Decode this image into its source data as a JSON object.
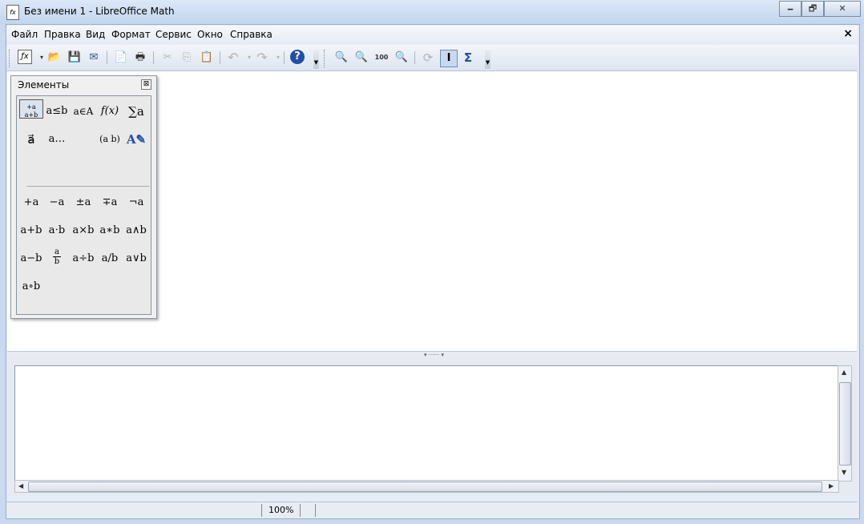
{
  "window": {
    "title": "Без имени 1 - LibreOffice Math",
    "controls": [
      "🗕",
      "🗗",
      "✕"
    ]
  },
  "menu": {
    "items": [
      "Файл",
      "Правка",
      "Вид",
      "Формат",
      "Сервис",
      "Окно",
      "Справка"
    ],
    "close_glyph": "×"
  },
  "toolbar": {
    "buttons": [
      {
        "icon": "new-formula-icon",
        "glyph": "ƒx"
      },
      {
        "icon": "open-folder-icon",
        "glyph": "📂"
      },
      {
        "icon": "save-icon",
        "glyph": "💾"
      },
      {
        "icon": "email-icon",
        "glyph": "✉"
      },
      {
        "icon": "export-pdf-icon",
        "glyph": "📄"
      },
      {
        "icon": "print-icon",
        "glyph": "🖶"
      },
      {
        "icon": "cut-icon",
        "glyph": "✂"
      },
      {
        "icon": "copy-icon",
        "glyph": "⎘"
      },
      {
        "icon": "paste-icon",
        "glyph": "📋"
      },
      {
        "icon": "undo-icon",
        "glyph": "↶"
      },
      {
        "icon": "redo-icon",
        "glyph": "↷"
      },
      {
        "icon": "help-icon",
        "glyph": "?"
      },
      {
        "icon": "zoom-in-icon",
        "glyph": "🔍"
      },
      {
        "icon": "zoom-out-icon",
        "glyph": "🔍"
      },
      {
        "icon": "zoom-100-icon",
        "glyph": "100"
      },
      {
        "icon": "zoom-icon",
        "glyph": "🔍"
      },
      {
        "icon": "update-icon",
        "glyph": "⟳"
      },
      {
        "icon": "formula-cursor-icon",
        "glyph": "I"
      },
      {
        "icon": "symbols-icon",
        "glyph": "Σ"
      }
    ]
  },
  "elements_panel": {
    "title": "Элементы",
    "close_glyph": "⊠",
    "categories": [
      "+a/a+b",
      "a≤b",
      "a∈A",
      "f(x)",
      "∑a",
      "a⃗",
      "a…",
      "(a b)",
      "A✎"
    ],
    "operators": [
      "+a",
      "−a",
      "±a",
      "∓a",
      "¬a",
      "a+b",
      "a⋅b",
      "a×b",
      "a∗b",
      "a∧b",
      "a−b",
      "a/b frac",
      "a÷b",
      "a/b",
      "a∨b",
      "a∘b"
    ]
  },
  "status": {
    "zoom": "100%"
  },
  "colors": {
    "accent": "#2a4f8a",
    "frame": "#c9daf0",
    "selected": "#dbe3ee"
  }
}
